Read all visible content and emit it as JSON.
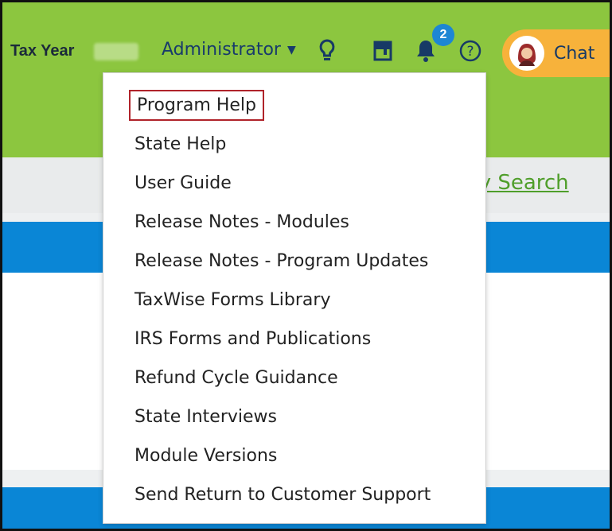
{
  "header": {
    "tax_year_label": "Tax Year",
    "user_label": "Administrator",
    "notification_count": "2",
    "chat_label": "Chat",
    "icons": [
      "lightbulb-icon",
      "book-icon",
      "bell-icon",
      "help-icon",
      "avatar-icon"
    ]
  },
  "page": {
    "search_link": "ry Search"
  },
  "help_menu": {
    "items": [
      "Program Help",
      "State Help",
      "User Guide",
      "Release Notes - Modules",
      "Release Notes - Program Updates",
      "TaxWise Forms Library",
      "IRS Forms and Publications",
      "Refund Cycle Guidance",
      "State Interviews",
      "Module Versions",
      "Send Return to Customer Support"
    ]
  },
  "colors": {
    "header_green": "#8cc63f",
    "accent_blue": "#0a86d6",
    "chat_orange": "#f7b23b",
    "highlight_red": "#b0232a",
    "link_green": "#4f9e2a"
  }
}
